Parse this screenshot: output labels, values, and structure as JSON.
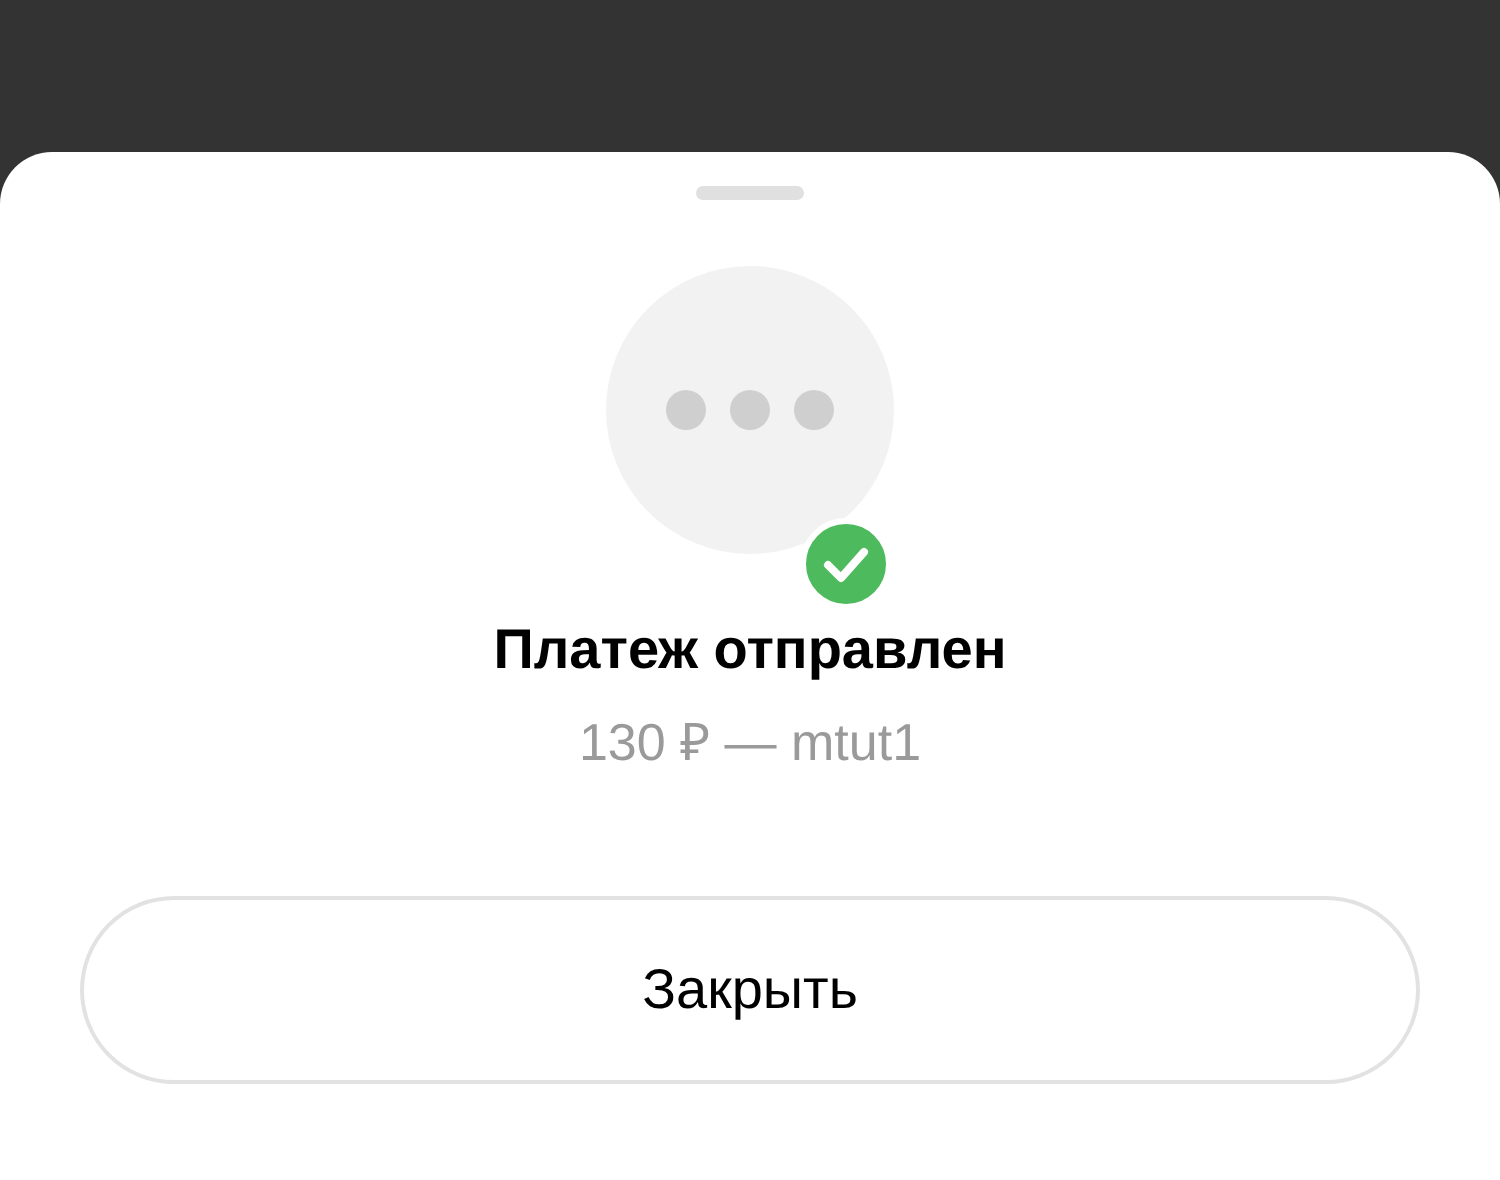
{
  "sheet": {
    "sent": true,
    "title": "Платеж отправлен",
    "subtitle": "130 ₽ — mtut1",
    "button": "Закрыть"
  }
}
